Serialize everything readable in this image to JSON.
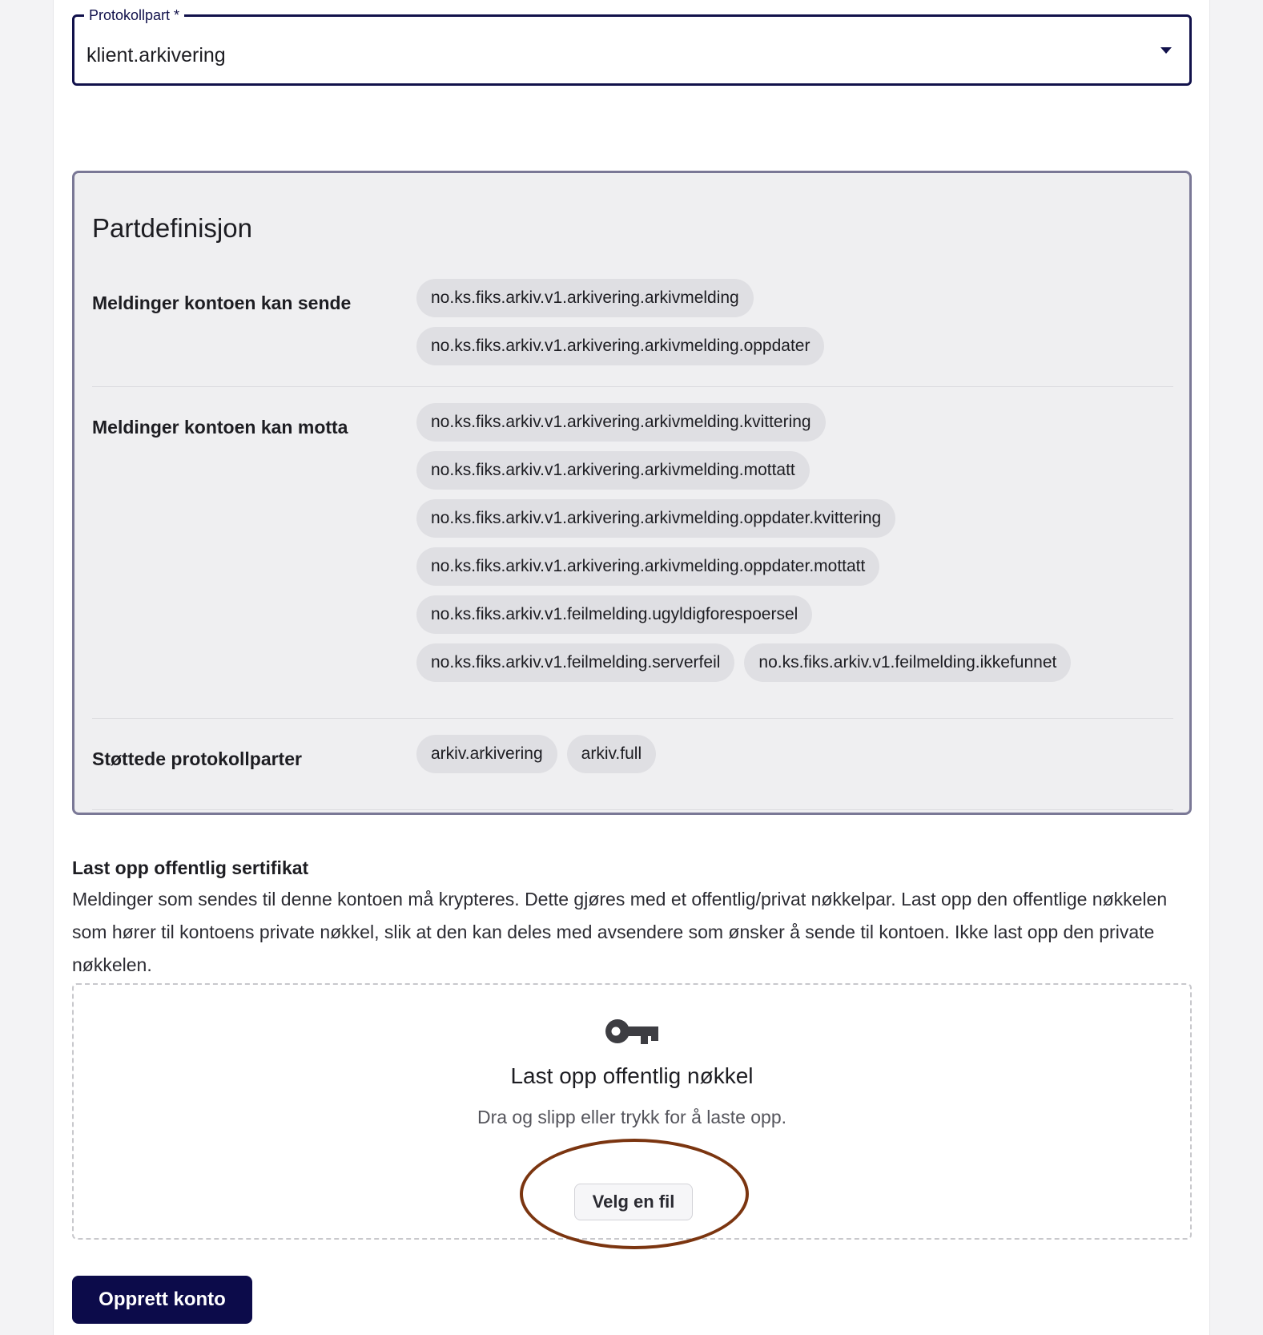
{
  "protocol_select": {
    "label": "Protokollpart *",
    "value": "klient.arkivering"
  },
  "party_definition": {
    "title": "Partdefinisjon",
    "send": {
      "label": "Meldinger kontoen kan sende",
      "messages": [
        "no.ks.fiks.arkiv.v1.arkivering.arkivmelding",
        "no.ks.fiks.arkiv.v1.arkivering.arkivmelding.oppdater"
      ]
    },
    "receive": {
      "label": "Meldinger kontoen kan motta",
      "messages": [
        "no.ks.fiks.arkiv.v1.arkivering.arkivmelding.kvittering",
        "no.ks.fiks.arkiv.v1.arkivering.arkivmelding.mottatt",
        "no.ks.fiks.arkiv.v1.arkivering.arkivmelding.oppdater.kvittering",
        "no.ks.fiks.arkiv.v1.arkivering.arkivmelding.oppdater.mottatt",
        "no.ks.fiks.arkiv.v1.feilmelding.ugyldigforespoersel",
        "no.ks.fiks.arkiv.v1.feilmelding.serverfeil",
        "no.ks.fiks.arkiv.v1.feilmelding.ikkefunnet"
      ]
    },
    "supported": {
      "label": "Støttede protokollparter",
      "parts": [
        "arkiv.arkivering",
        "arkiv.full"
      ]
    }
  },
  "upload": {
    "heading": "Last opp offentlig sertifikat",
    "description": "Meldinger som sendes til denne kontoen må krypteres. Dette gjøres med et offentlig/privat nøkkelpar. Last opp den offentlige nøkkelen som hører til kontoens private nøkkel, slik at den kan deles med avsendere som ønsker å sende til kontoen. Ikke last opp den private nøkkelen.",
    "icon": "key-icon",
    "drop_title": "Last opp offentlig nøkkel",
    "drop_subtitle": "Dra og slipp eller trykk for å laste opp.",
    "button_label": "Velg en fil"
  },
  "submit": {
    "label": "Opprett konto"
  },
  "colors": {
    "primary": "#0c0b4a",
    "highlight_ring": "#7b3510",
    "panel_border": "#7a7896"
  }
}
